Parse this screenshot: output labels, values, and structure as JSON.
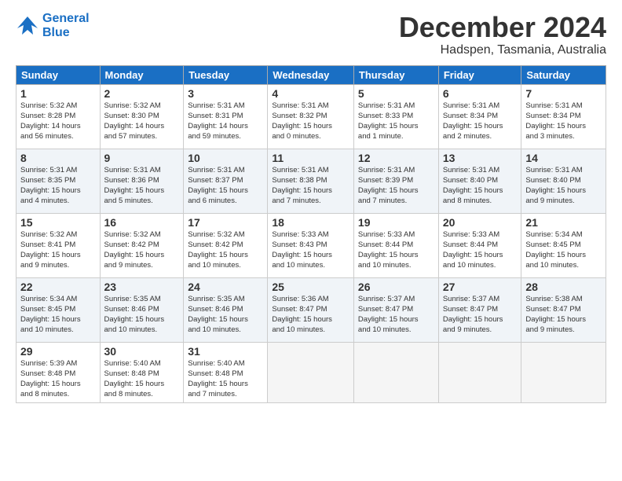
{
  "logo": {
    "line1": "General",
    "line2": "Blue"
  },
  "title": "December 2024",
  "subtitle": "Hadspen, Tasmania, Australia",
  "days_of_week": [
    "Sunday",
    "Monday",
    "Tuesday",
    "Wednesday",
    "Thursday",
    "Friday",
    "Saturday"
  ],
  "weeks": [
    [
      {
        "day": "1",
        "info": "Sunrise: 5:32 AM\nSunset: 8:28 PM\nDaylight: 14 hours\nand 56 minutes."
      },
      {
        "day": "2",
        "info": "Sunrise: 5:32 AM\nSunset: 8:30 PM\nDaylight: 14 hours\nand 57 minutes."
      },
      {
        "day": "3",
        "info": "Sunrise: 5:31 AM\nSunset: 8:31 PM\nDaylight: 14 hours\nand 59 minutes."
      },
      {
        "day": "4",
        "info": "Sunrise: 5:31 AM\nSunset: 8:32 PM\nDaylight: 15 hours\nand 0 minutes."
      },
      {
        "day": "5",
        "info": "Sunrise: 5:31 AM\nSunset: 8:33 PM\nDaylight: 15 hours\nand 1 minute."
      },
      {
        "day": "6",
        "info": "Sunrise: 5:31 AM\nSunset: 8:34 PM\nDaylight: 15 hours\nand 2 minutes."
      },
      {
        "day": "7",
        "info": "Sunrise: 5:31 AM\nSunset: 8:34 PM\nDaylight: 15 hours\nand 3 minutes."
      }
    ],
    [
      {
        "day": "8",
        "info": "Sunrise: 5:31 AM\nSunset: 8:35 PM\nDaylight: 15 hours\nand 4 minutes."
      },
      {
        "day": "9",
        "info": "Sunrise: 5:31 AM\nSunset: 8:36 PM\nDaylight: 15 hours\nand 5 minutes."
      },
      {
        "day": "10",
        "info": "Sunrise: 5:31 AM\nSunset: 8:37 PM\nDaylight: 15 hours\nand 6 minutes."
      },
      {
        "day": "11",
        "info": "Sunrise: 5:31 AM\nSunset: 8:38 PM\nDaylight: 15 hours\nand 7 minutes."
      },
      {
        "day": "12",
        "info": "Sunrise: 5:31 AM\nSunset: 8:39 PM\nDaylight: 15 hours\nand 7 minutes."
      },
      {
        "day": "13",
        "info": "Sunrise: 5:31 AM\nSunset: 8:40 PM\nDaylight: 15 hours\nand 8 minutes."
      },
      {
        "day": "14",
        "info": "Sunrise: 5:31 AM\nSunset: 8:40 PM\nDaylight: 15 hours\nand 9 minutes."
      }
    ],
    [
      {
        "day": "15",
        "info": "Sunrise: 5:32 AM\nSunset: 8:41 PM\nDaylight: 15 hours\nand 9 minutes."
      },
      {
        "day": "16",
        "info": "Sunrise: 5:32 AM\nSunset: 8:42 PM\nDaylight: 15 hours\nand 9 minutes."
      },
      {
        "day": "17",
        "info": "Sunrise: 5:32 AM\nSunset: 8:42 PM\nDaylight: 15 hours\nand 10 minutes."
      },
      {
        "day": "18",
        "info": "Sunrise: 5:33 AM\nSunset: 8:43 PM\nDaylight: 15 hours\nand 10 minutes."
      },
      {
        "day": "19",
        "info": "Sunrise: 5:33 AM\nSunset: 8:44 PM\nDaylight: 15 hours\nand 10 minutes."
      },
      {
        "day": "20",
        "info": "Sunrise: 5:33 AM\nSunset: 8:44 PM\nDaylight: 15 hours\nand 10 minutes."
      },
      {
        "day": "21",
        "info": "Sunrise: 5:34 AM\nSunset: 8:45 PM\nDaylight: 15 hours\nand 10 minutes."
      }
    ],
    [
      {
        "day": "22",
        "info": "Sunrise: 5:34 AM\nSunset: 8:45 PM\nDaylight: 15 hours\nand 10 minutes."
      },
      {
        "day": "23",
        "info": "Sunrise: 5:35 AM\nSunset: 8:46 PM\nDaylight: 15 hours\nand 10 minutes."
      },
      {
        "day": "24",
        "info": "Sunrise: 5:35 AM\nSunset: 8:46 PM\nDaylight: 15 hours\nand 10 minutes."
      },
      {
        "day": "25",
        "info": "Sunrise: 5:36 AM\nSunset: 8:47 PM\nDaylight: 15 hours\nand 10 minutes."
      },
      {
        "day": "26",
        "info": "Sunrise: 5:37 AM\nSunset: 8:47 PM\nDaylight: 15 hours\nand 10 minutes."
      },
      {
        "day": "27",
        "info": "Sunrise: 5:37 AM\nSunset: 8:47 PM\nDaylight: 15 hours\nand 9 minutes."
      },
      {
        "day": "28",
        "info": "Sunrise: 5:38 AM\nSunset: 8:47 PM\nDaylight: 15 hours\nand 9 minutes."
      }
    ],
    [
      {
        "day": "29",
        "info": "Sunrise: 5:39 AM\nSunset: 8:48 PM\nDaylight: 15 hours\nand 8 minutes."
      },
      {
        "day": "30",
        "info": "Sunrise: 5:40 AM\nSunset: 8:48 PM\nDaylight: 15 hours\nand 8 minutes."
      },
      {
        "day": "31",
        "info": "Sunrise: 5:40 AM\nSunset: 8:48 PM\nDaylight: 15 hours\nand 7 minutes."
      },
      {
        "day": "",
        "info": ""
      },
      {
        "day": "",
        "info": ""
      },
      {
        "day": "",
        "info": ""
      },
      {
        "day": "",
        "info": ""
      }
    ]
  ]
}
